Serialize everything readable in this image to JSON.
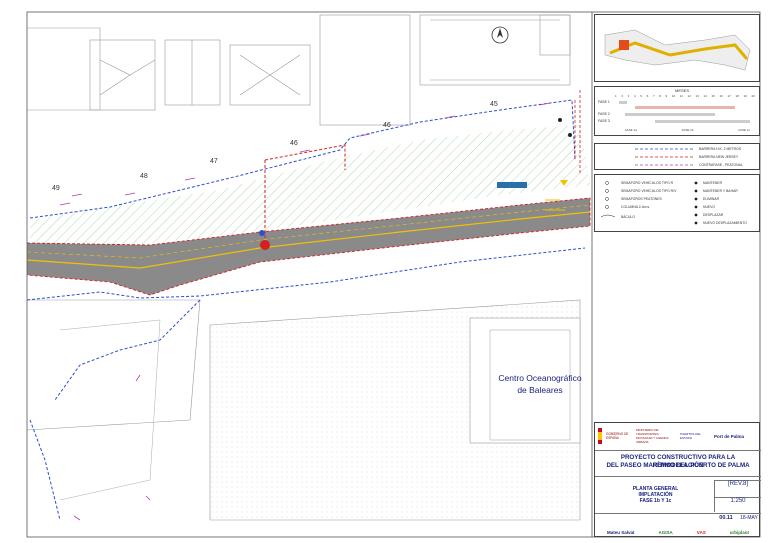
{
  "map": {
    "building_label_line1": "Centro Oceanográfico",
    "building_label_line2": "de Baleares",
    "parcel_numbers": [
      "49",
      "48",
      "47",
      "46",
      "46",
      "45"
    ],
    "colors": {
      "road": "#8a8a8a",
      "road_line": "#f2c200",
      "barrier_blue": "#2a4fd0",
      "barrier_red": "#d42020",
      "hatch_green": "#79c379",
      "arrow_magenta": "#b03ab0",
      "building_stroke": "#9a9a9a"
    }
  },
  "gantt": {
    "header": "MESES",
    "months": [
      "1",
      "2",
      "3",
      "4",
      "5",
      "6",
      "7",
      "8",
      "9",
      "10",
      "11",
      "12",
      "13",
      "14",
      "15",
      "16",
      "17",
      "18",
      "19",
      "20"
    ],
    "phases": [
      "FASE 1",
      "FASE 2",
      "FASE 3"
    ],
    "footer": [
      "FASE 1a",
      "FASE 1b",
      "FASE 1c"
    ]
  },
  "legend": {
    "lines": [
      "BARRERA H.K. 2 METROS",
      "BARRERA NEW JERSEY",
      "CONTRAFASE - PEATONAL"
    ],
    "left_items": [
      "SEMÁFORO VEHÍCULOS TIPO R",
      "SEMÁFORO VEHÍCULOS TIPO R/V",
      "SEMÁFOROS PEATONES",
      "COLUMNA 2-4m.s.",
      "BÁCULO"
    ],
    "right_items": [
      "MANTENER",
      "MANTENER Y BAHAR",
      "ELIMINAR",
      "NUEVO",
      "DESPLAZAR",
      "NUEVO DESPLAZAMIENTO"
    ]
  },
  "title_block": {
    "logos": [
      "GOBIERNO DE ESPAÑA",
      "MINISTERIO DE TRANSPORTES, MOVILIDAD Y AGENDA URBANA",
      "PUERTOS DEL ESTADO",
      "Port de Palma"
    ],
    "project_line1": "PROYECTO CONSTRUCTIVO PARA LA REMODELACIÓN",
    "project_line2": "DEL PASEO MARÍTIMO DEL PUERTO DE PALMA",
    "plan_line1": "PLANTA GENERAL",
    "plan_line2": "IMPLATACIÓN",
    "plan_line3": "FASE 1b Y 1c",
    "revision": "[REV.8]",
    "scale": "1:250",
    "sheet": "00.11",
    "date": "18-MAY",
    "bottom_logos": [
      "Mateu Salvat",
      "AGISA",
      "VAS",
      "urbiplant"
    ]
  }
}
